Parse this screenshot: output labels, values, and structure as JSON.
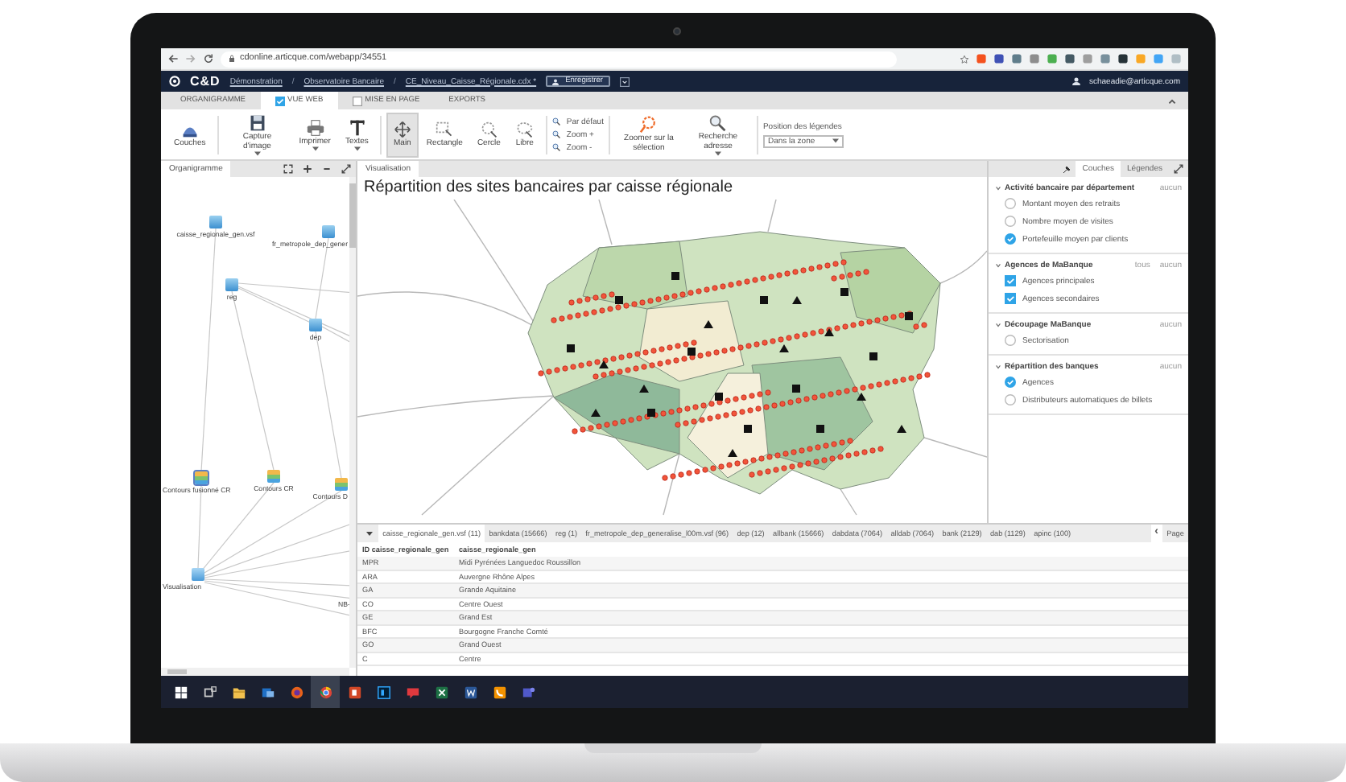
{
  "browser": {
    "url": "cdonline.articque.com/webapp/34551",
    "extensions": [
      {
        "selected": false
      },
      {
        "selected": false
      },
      {
        "selected": false
      },
      {
        "selected": false
      },
      {
        "selected": false
      },
      {
        "selected": false
      },
      {
        "selected": false
      },
      {
        "selected": false
      },
      {
        "selected": false
      },
      {
        "selected": false
      },
      {
        "selected": false
      },
      {
        "selected": false
      }
    ]
  },
  "app_header": {
    "logo": "C&D",
    "breadcrumbs": [
      "Démonstration",
      "Observatoire Bancaire",
      "CE_Niveau_Caisse_Régionale.cdx *"
    ],
    "separator": "/",
    "save_button": "Enregistrer",
    "user": "schaeadie@articque.com"
  },
  "ribbon_tabs": [
    {
      "label": "ORGANIGRAMME",
      "kind": "plain",
      "selected": false
    },
    {
      "label": "VUE WEB",
      "kind": "toggle",
      "checked": true,
      "selected": true
    },
    {
      "label": "MISE EN PAGE",
      "kind": "toggle",
      "checked": false,
      "selected": false
    },
    {
      "label": "EXPORTS",
      "kind": "plain",
      "selected": false
    }
  ],
  "toolbar": [
    {
      "kind": "big",
      "label": "Couches",
      "selected": false,
      "dropdown": false
    },
    {
      "kind": "big",
      "label": "Capture d'image",
      "selected": false,
      "dropdown": true
    },
    {
      "kind": "big",
      "label": "Imprimer",
      "selected": false,
      "dropdown": true
    },
    {
      "kind": "big",
      "label": "Textes",
      "selected": false,
      "dropdown": true
    },
    {
      "kind": "big",
      "label": "Main",
      "selected": true,
      "dropdown": false
    },
    {
      "kind": "big",
      "label": "Rectangle",
      "selected": false,
      "dropdown": false
    },
    {
      "kind": "big",
      "label": "Cercle",
      "selected": false,
      "dropdown": false
    },
    {
      "kind": "big",
      "label": "Libre",
      "selected": false,
      "dropdown": false
    },
    {
      "kind": "stack",
      "items": [
        "Par défaut",
        "Zoom +",
        "Zoom -"
      ]
    },
    {
      "kind": "big",
      "label": "Zoomer sur la sélection",
      "selected": false,
      "dropdown": false
    },
    {
      "kind": "big",
      "label": "Recherche adresse",
      "selected": false,
      "dropdown": true
    },
    {
      "kind": "select",
      "label": "Position des légendes",
      "value": "Dans la zone"
    }
  ],
  "organigram": {
    "title": "Organigramme",
    "nodes": [
      {
        "kind": "data",
        "label": "caisse_regionale_gen.vsf"
      },
      {
        "kind": "data",
        "label": "fr_metropole_dep_gener"
      },
      {
        "kind": "data",
        "label": "reg"
      },
      {
        "kind": "data",
        "label": "dep"
      },
      {
        "kind": "contours",
        "label": "Contours fusionné CR"
      },
      {
        "kind": "contours",
        "label": "Contours CR"
      },
      {
        "kind": "contours",
        "label": "Contours D"
      },
      {
        "kind": "view",
        "label": "Visualisation"
      },
      {
        "kind": "text",
        "label": "NB-"
      }
    ]
  },
  "visualization": {
    "tab": "Visualisation",
    "title": "Répartition des sites bancaires par caisse régionale"
  },
  "legend_panel": {
    "tabs": [
      {
        "label": "Couches",
        "selected": true
      },
      {
        "label": "Légendes",
        "selected": false
      }
    ],
    "sections": [
      {
        "title": "Activité bancaire par département",
        "actions": [
          "aucun"
        ],
        "items": [
          {
            "kind": "radio",
            "label": "Montant moyen des retraits",
            "checked": false
          },
          {
            "kind": "radio",
            "label": "Nombre moyen de visites",
            "checked": false
          },
          {
            "kind": "radio",
            "label": "Portefeuille moyen par clients",
            "checked": true
          }
        ]
      },
      {
        "title": "Agences de MaBanque",
        "actions": [
          "tous",
          "aucun"
        ],
        "items": [
          {
            "kind": "checkbox",
            "label": "Agences principales",
            "checked": true
          },
          {
            "kind": "checkbox",
            "label": "Agences secondaires",
            "checked": true
          }
        ]
      },
      {
        "title": "Découpage MaBanque",
        "actions": [
          "aucun"
        ],
        "items": [
          {
            "kind": "radio",
            "label": "Sectorisation",
            "checked": false
          }
        ]
      },
      {
        "title": "Répartition des banques",
        "actions": [
          "aucun"
        ],
        "items": [
          {
            "kind": "radio",
            "label": "Agences",
            "checked": true
          },
          {
            "kind": "radio",
            "label": "Distributeurs automatiques de billets",
            "checked": false
          }
        ]
      }
    ]
  },
  "data_table": {
    "tabs": [
      {
        "label": "caisse_regionale_gen.vsf (11)",
        "selected": true
      },
      {
        "label": "bankdata (15666)",
        "selected": false
      },
      {
        "label": "reg (1)",
        "selected": false
      },
      {
        "label": "fr_metropole_dep_generalise_l00m.vsf (96)",
        "selected": false
      },
      {
        "label": "dep (12)",
        "selected": false
      },
      {
        "label": "allbank (15666)",
        "selected": false
      },
      {
        "label": "dabdata (7064)",
        "selected": false
      },
      {
        "label": "alldab (7064)",
        "selected": false
      },
      {
        "label": "bank (2129)",
        "selected": false
      },
      {
        "label": "dab (1129)",
        "selected": false
      },
      {
        "label": "apinc (100)",
        "selected": false
      }
    ],
    "pager": {
      "prev": "‹",
      "label": "Page"
    },
    "columns": [
      "ID caisse_regionale_gen",
      "caisse_regionale_gen"
    ],
    "rows": [
      [
        "MPR",
        "Midi Pyrénées Languedoc Roussillon"
      ],
      [
        "ARA",
        "Auvergne Rhône Alpes"
      ],
      [
        "GA",
        "Grande Aquitaine"
      ],
      [
        "CO",
        "Centre Ouest"
      ],
      [
        "GE",
        "Grand Est"
      ],
      [
        "BFC",
        "Bourgogne Franche Comté"
      ],
      [
        "GO",
        "Grand Ouest"
      ],
      [
        "C",
        "Centre"
      ]
    ]
  },
  "taskbar": {
    "apps": [
      {
        "selected": false
      },
      {
        "selected": false
      },
      {
        "selected": false
      },
      {
        "selected": false
      },
      {
        "selected": false
      },
      {
        "selected": true
      },
      {
        "selected": false
      },
      {
        "selected": false
      },
      {
        "selected": false
      },
      {
        "selected": false
      },
      {
        "selected": false
      },
      {
        "selected": false
      },
      {
        "selected": false
      }
    ]
  }
}
